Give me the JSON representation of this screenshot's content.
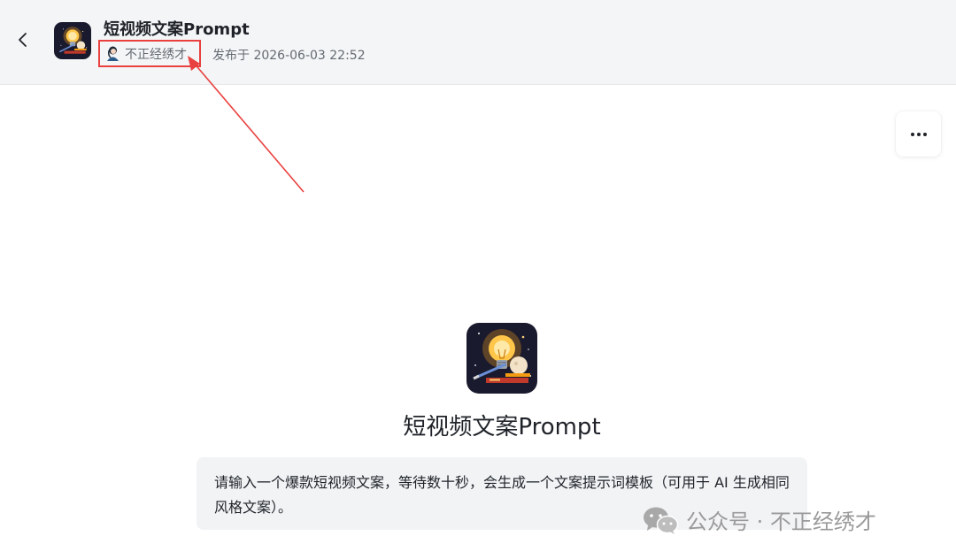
{
  "header": {
    "back_icon": "chevron-left-icon",
    "title": "短视频文案Prompt",
    "author": "不正经绣才",
    "publish_time": "发布于 2026-06-03 22:52"
  },
  "toolbar": {
    "more_icon": "ellipsis-icon"
  },
  "main": {
    "app_title": "短视频文案Prompt",
    "description": "请输入一个爆款短视频文案，等待数十秒，会生成一个文案提示词模板（可用于 AI 生成相同风格文案）。"
  },
  "watermark": {
    "text": "公众号 · 不正经绣才"
  },
  "colors": {
    "annotation_red": "#e8413f",
    "header_bg": "#f4f5f6",
    "description_bg": "#f2f3f5"
  }
}
